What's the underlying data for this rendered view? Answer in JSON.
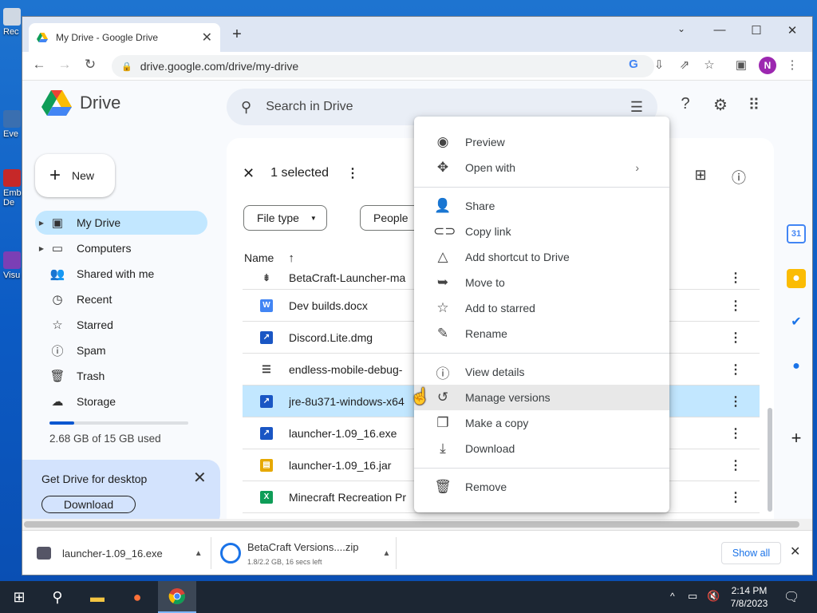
{
  "desktop": {
    "icons": [
      {
        "label": "Rec"
      },
      {
        "label": "Eve"
      },
      {
        "label": "Emb De"
      },
      {
        "label": "Visu"
      }
    ]
  },
  "browser": {
    "tab_title": "My Drive - Google Drive",
    "url": "drive.google.com/drive/my-drive",
    "profile_initial": "N"
  },
  "drive": {
    "logo_text": "Drive",
    "search_placeholder": "Search in Drive",
    "new_label": "New",
    "nav": [
      {
        "label": "My Drive",
        "icon": "my-drive-icon"
      },
      {
        "label": "Computers",
        "icon": "computer-icon"
      },
      {
        "label": "Shared with me",
        "icon": "people-icon"
      },
      {
        "label": "Recent",
        "icon": "clock-icon"
      },
      {
        "label": "Starred",
        "icon": "star-icon"
      },
      {
        "label": "Spam",
        "icon": "spam-icon"
      },
      {
        "label": "Trash",
        "icon": "trash-icon"
      },
      {
        "label": "Storage",
        "icon": "cloud-icon"
      }
    ],
    "storage_used": "2.68 GB of 15 GB used",
    "storage_fraction": 0.18,
    "promo_title": "Get Drive for desktop",
    "promo_button": "Download",
    "selection_text": "1 selected",
    "filters": [
      "File type",
      "People"
    ],
    "column_name": "Name",
    "files": [
      {
        "name": "BetaCraft-Launcher-ma",
        "type": "zip"
      },
      {
        "name": "Dev builds.docx",
        "type": "docx"
      },
      {
        "name": "Discord.Lite.dmg",
        "type": "binary"
      },
      {
        "name": "endless-mobile-debug-",
        "type": "list"
      },
      {
        "name": "jre-8u371-windows-x64",
        "type": "binary"
      },
      {
        "name": "launcher-1.09_16.exe",
        "type": "binary"
      },
      {
        "name": "launcher-1.09_16.jar",
        "type": "archive"
      },
      {
        "name": "Minecraft Recreation Pr",
        "type": "sheet"
      }
    ]
  },
  "context_menu": {
    "groups": [
      [
        {
          "label": "Preview",
          "icon": "eye-icon"
        },
        {
          "label": "Open with",
          "icon": "move-arrows-icon",
          "submenu": true
        }
      ],
      [
        {
          "label": "Share",
          "icon": "person-add-icon"
        },
        {
          "label": "Copy link",
          "icon": "link-icon"
        },
        {
          "label": "Add shortcut to Drive",
          "icon": "add-shortcut-icon"
        },
        {
          "label": "Move to",
          "icon": "move-to-icon"
        },
        {
          "label": "Add to starred",
          "icon": "star-icon"
        },
        {
          "label": "Rename",
          "icon": "pencil-icon"
        }
      ],
      [
        {
          "label": "View details",
          "icon": "info-icon"
        },
        {
          "label": "Manage versions",
          "icon": "history-icon"
        },
        {
          "label": "Make a copy",
          "icon": "copy-icon"
        },
        {
          "label": "Download",
          "icon": "download-icon"
        }
      ],
      [
        {
          "label": "Remove",
          "icon": "trash-icon"
        }
      ]
    ]
  },
  "downloads": {
    "items": [
      {
        "name": "launcher-1.09_16.exe",
        "status": ""
      },
      {
        "name": "BetaCraft Versions....zip",
        "status": "1.8/2.2 GB, 16 secs left"
      }
    ],
    "show_all": "Show all"
  },
  "taskbar": {
    "time": "2:14 PM",
    "date": "7/8/2023"
  },
  "colors": {
    "accent": "#0b57d0",
    "selected_bg": "#c2e7ff",
    "promo_bg": "#d3e3fd"
  }
}
